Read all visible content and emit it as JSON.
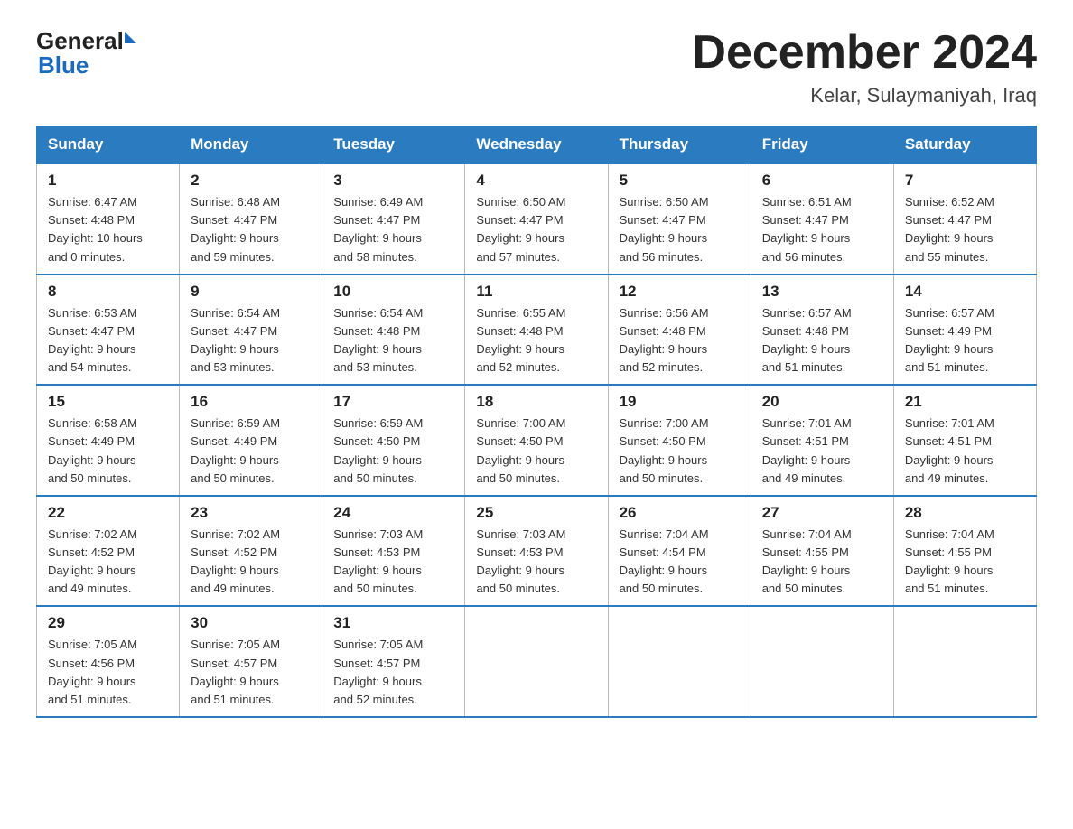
{
  "header": {
    "logo_general": "General",
    "logo_blue": "Blue",
    "month_title": "December 2024",
    "location": "Kelar, Sulaymaniyah, Iraq"
  },
  "days_of_week": [
    "Sunday",
    "Monday",
    "Tuesday",
    "Wednesday",
    "Thursday",
    "Friday",
    "Saturday"
  ],
  "weeks": [
    [
      {
        "day": "1",
        "sunrise": "6:47 AM",
        "sunset": "4:48 PM",
        "daylight_hours": "10",
        "daylight_minutes": "0"
      },
      {
        "day": "2",
        "sunrise": "6:48 AM",
        "sunset": "4:47 PM",
        "daylight_hours": "9",
        "daylight_minutes": "59"
      },
      {
        "day": "3",
        "sunrise": "6:49 AM",
        "sunset": "4:47 PM",
        "daylight_hours": "9",
        "daylight_minutes": "58"
      },
      {
        "day": "4",
        "sunrise": "6:50 AM",
        "sunset": "4:47 PM",
        "daylight_hours": "9",
        "daylight_minutes": "57"
      },
      {
        "day": "5",
        "sunrise": "6:50 AM",
        "sunset": "4:47 PM",
        "daylight_hours": "9",
        "daylight_minutes": "56"
      },
      {
        "day": "6",
        "sunrise": "6:51 AM",
        "sunset": "4:47 PM",
        "daylight_hours": "9",
        "daylight_minutes": "56"
      },
      {
        "day": "7",
        "sunrise": "6:52 AM",
        "sunset": "4:47 PM",
        "daylight_hours": "9",
        "daylight_minutes": "55"
      }
    ],
    [
      {
        "day": "8",
        "sunrise": "6:53 AM",
        "sunset": "4:47 PM",
        "daylight_hours": "9",
        "daylight_minutes": "54"
      },
      {
        "day": "9",
        "sunrise": "6:54 AM",
        "sunset": "4:47 PM",
        "daylight_hours": "9",
        "daylight_minutes": "53"
      },
      {
        "day": "10",
        "sunrise": "6:54 AM",
        "sunset": "4:48 PM",
        "daylight_hours": "9",
        "daylight_minutes": "53"
      },
      {
        "day": "11",
        "sunrise": "6:55 AM",
        "sunset": "4:48 PM",
        "daylight_hours": "9",
        "daylight_minutes": "52"
      },
      {
        "day": "12",
        "sunrise": "6:56 AM",
        "sunset": "4:48 PM",
        "daylight_hours": "9",
        "daylight_minutes": "52"
      },
      {
        "day": "13",
        "sunrise": "6:57 AM",
        "sunset": "4:48 PM",
        "daylight_hours": "9",
        "daylight_minutes": "51"
      },
      {
        "day": "14",
        "sunrise": "6:57 AM",
        "sunset": "4:49 PM",
        "daylight_hours": "9",
        "daylight_minutes": "51"
      }
    ],
    [
      {
        "day": "15",
        "sunrise": "6:58 AM",
        "sunset": "4:49 PM",
        "daylight_hours": "9",
        "daylight_minutes": "50"
      },
      {
        "day": "16",
        "sunrise": "6:59 AM",
        "sunset": "4:49 PM",
        "daylight_hours": "9",
        "daylight_minutes": "50"
      },
      {
        "day": "17",
        "sunrise": "6:59 AM",
        "sunset": "4:50 PM",
        "daylight_hours": "9",
        "daylight_minutes": "50"
      },
      {
        "day": "18",
        "sunrise": "7:00 AM",
        "sunset": "4:50 PM",
        "daylight_hours": "9",
        "daylight_minutes": "50"
      },
      {
        "day": "19",
        "sunrise": "7:00 AM",
        "sunset": "4:50 PM",
        "daylight_hours": "9",
        "daylight_minutes": "50"
      },
      {
        "day": "20",
        "sunrise": "7:01 AM",
        "sunset": "4:51 PM",
        "daylight_hours": "9",
        "daylight_minutes": "49"
      },
      {
        "day": "21",
        "sunrise": "7:01 AM",
        "sunset": "4:51 PM",
        "daylight_hours": "9",
        "daylight_minutes": "49"
      }
    ],
    [
      {
        "day": "22",
        "sunrise": "7:02 AM",
        "sunset": "4:52 PM",
        "daylight_hours": "9",
        "daylight_minutes": "49"
      },
      {
        "day": "23",
        "sunrise": "7:02 AM",
        "sunset": "4:52 PM",
        "daylight_hours": "9",
        "daylight_minutes": "49"
      },
      {
        "day": "24",
        "sunrise": "7:03 AM",
        "sunset": "4:53 PM",
        "daylight_hours": "9",
        "daylight_minutes": "50"
      },
      {
        "day": "25",
        "sunrise": "7:03 AM",
        "sunset": "4:53 PM",
        "daylight_hours": "9",
        "daylight_minutes": "50"
      },
      {
        "day": "26",
        "sunrise": "7:04 AM",
        "sunset": "4:54 PM",
        "daylight_hours": "9",
        "daylight_minutes": "50"
      },
      {
        "day": "27",
        "sunrise": "7:04 AM",
        "sunset": "4:55 PM",
        "daylight_hours": "9",
        "daylight_minutes": "50"
      },
      {
        "day": "28",
        "sunrise": "7:04 AM",
        "sunset": "4:55 PM",
        "daylight_hours": "9",
        "daylight_minutes": "51"
      }
    ],
    [
      {
        "day": "29",
        "sunrise": "7:05 AM",
        "sunset": "4:56 PM",
        "daylight_hours": "9",
        "daylight_minutes": "51"
      },
      {
        "day": "30",
        "sunrise": "7:05 AM",
        "sunset": "4:57 PM",
        "daylight_hours": "9",
        "daylight_minutes": "51"
      },
      {
        "day": "31",
        "sunrise": "7:05 AM",
        "sunset": "4:57 PM",
        "daylight_hours": "9",
        "daylight_minutes": "52"
      },
      null,
      null,
      null,
      null
    ]
  ],
  "labels": {
    "sunrise": "Sunrise:",
    "sunset": "Sunset:",
    "daylight": "Daylight:",
    "hours_suffix": "hours",
    "and": "and",
    "minutes_suffix": "minutes."
  }
}
